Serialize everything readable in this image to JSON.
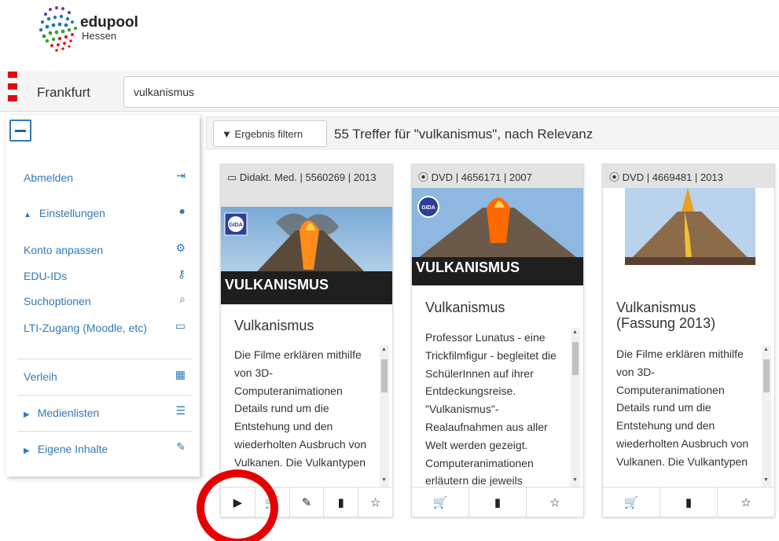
{
  "logo": {
    "name": "edupool",
    "sub": "Hessen"
  },
  "header": {
    "city": "Frankfurt",
    "search_value": "vulkanismus"
  },
  "sidebar": {
    "collapse_icon": "minus-icon",
    "items": [
      {
        "label": "Abmelden",
        "icon": "sign-in-icon",
        "glyph": "➜"
      },
      {
        "label": "Einstellungen",
        "icon": "user-icon",
        "glyph": "👤"
      },
      {
        "label": "Konto anpassen",
        "icon": "gear-icon",
        "glyph": "⚙"
      },
      {
        "label": "EDU-IDs",
        "icon": "key-icon",
        "glyph": "⚷"
      },
      {
        "label": "Suchoptionen",
        "icon": "search-icon",
        "glyph": "🔍"
      },
      {
        "label": "LTI-Zugang (Moodle, etc)",
        "icon": "desktop-icon",
        "glyph": "🖥"
      },
      {
        "label": "Verleih",
        "icon": "calendar-icon",
        "glyph": "📅"
      },
      {
        "label": "Medienlisten",
        "icon": "list-icon",
        "glyph": "☰"
      },
      {
        "label": "Eigene Inhalte",
        "icon": "edit-icon",
        "glyph": "✎"
      }
    ]
  },
  "results": {
    "filter_label": "Ergebnis filtern",
    "summary": "55 Treffer für \"vulkanismus\", nach Relevanz"
  },
  "cards": [
    {
      "head": "Didakt. Med. | 5560269 | 2013",
      "head_icon": "desktop-icon",
      "banner": "VULKANISMUS",
      "title": "Vulkanismus",
      "desc": "Die Filme erklären mithilfe von 3D-Computeranimationen Details rund um die Entstehung und den wiederholten Ausbruch von Vulkanen. Die Vulkantypen",
      "actions": [
        "play-icon",
        "cart-icon",
        "edit-icon",
        "file-icon",
        "star-icon"
      ]
    },
    {
      "head": "DVD | 4656171 | 2007",
      "head_icon": "disc-icon",
      "banner": "VULKANISMUS",
      "title": "Vulkanismus",
      "desc": "Professor Lunatus - eine Trickfilmfigur - begleitet die SchülerInnen auf ihrer Entdeckungsreise. \"Vulkanismus\"-Realaufnahmen aus aller Welt werden gezeigt. Computeranimationen erläutern die jeweils",
      "actions": [
        "cart-icon",
        "file-icon",
        "star-icon"
      ]
    },
    {
      "head": "DVD | 4669481 | 2013",
      "head_icon": "disc-icon",
      "banner": "",
      "title": "Vulkanismus (Fassung 2013)",
      "desc": "Die Filme erklären mithilfe von 3D-Computeranimationen Details rund um die Entstehung und den wiederholten Ausbruch von Vulkanen. Die Vulkantypen",
      "actions": [
        "cart-icon",
        "file-icon",
        "star-icon"
      ]
    }
  ],
  "gida_badge": "GIDA",
  "colors": {
    "accent": "#337ab7",
    "brand_red": "#e30613",
    "highlight": "#e60000"
  }
}
